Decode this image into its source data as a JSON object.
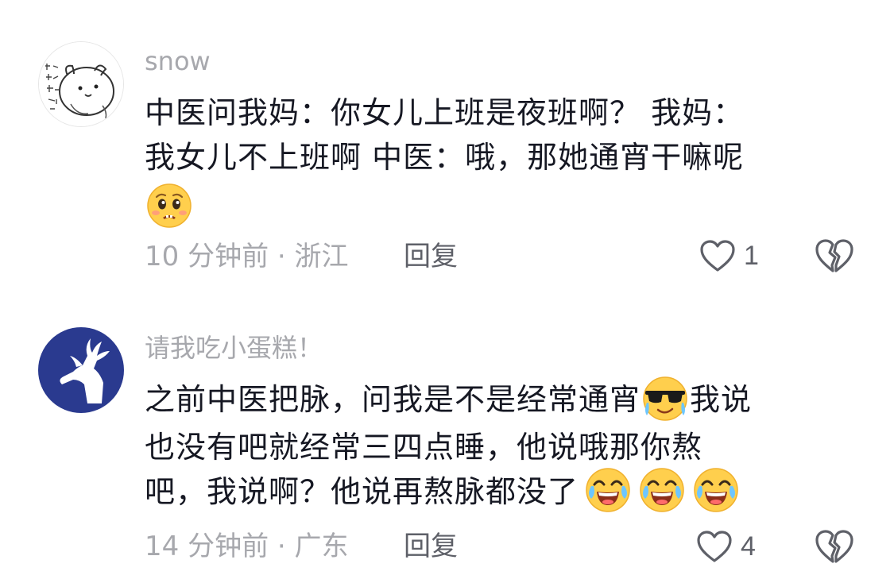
{
  "comments": [
    {
      "avatar": "sketch-hamster-avatar",
      "username": "snow",
      "text_line1": "中医问我妈：你女儿上班是夜班啊？ 我妈：",
      "text_line2": "我女儿不上班啊 中医：哦，那她通宵干嘛呢",
      "emoji": "pleading-face-emoji",
      "time": "10 分钟前",
      "location": "浙江",
      "meta": "10 分钟前 · 浙江",
      "reply_label": "回复",
      "like_count": "1"
    },
    {
      "avatar": "white-deer-avatar",
      "username": "请我吃小蛋糕！",
      "text_line1_a": "之前中医把脉，问我是不是经常通宵",
      "text_line1_b": "我说",
      "text_line2": "也没有吧就经常三四点睡，他说哦那你熬",
      "text_line3": "吧，我说啊？他说再熬脉都没了",
      "emoji_inline": "cool-crying-emoji",
      "emoji_tail": [
        "crying-laughing-emoji",
        "crying-laughing-emoji",
        "crying-laughing-emoji"
      ],
      "time": "14 分钟前",
      "location": "广东",
      "meta": "14 分钟前 · 广东",
      "reply_label": "回复",
      "like_count": "4"
    }
  ],
  "colors": {
    "text": "#161823",
    "secondary": "#a7a8ad",
    "action": "#5e6068",
    "deer_avatar_bg": "#2a3a8f"
  }
}
